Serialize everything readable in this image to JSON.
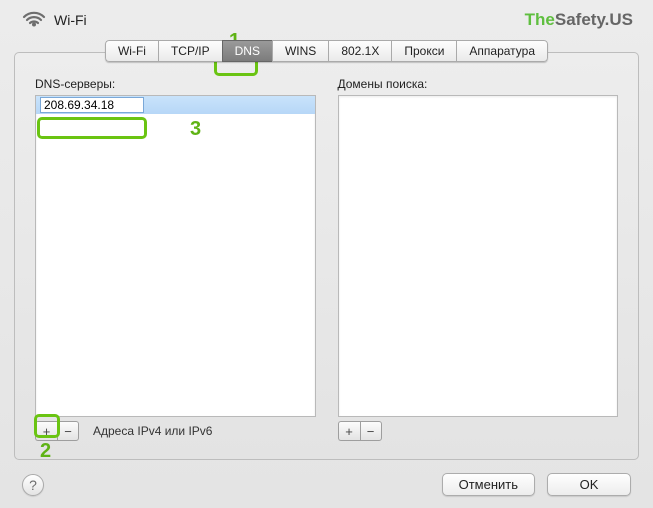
{
  "header": {
    "title": "Wi-Fi"
  },
  "brand": {
    "t1": "The",
    "t2": "Safety",
    "t3": ".US"
  },
  "tabs": {
    "t0": "Wi-Fi",
    "t1": "TCP/IP",
    "t2": "DNS",
    "t3": "WINS",
    "t4": "802.1X",
    "t5": "Прокси",
    "t6": "Аппаратура"
  },
  "left": {
    "label": "DNS-серверы:",
    "entry": "208.69.34.18",
    "hint": "Адреса IPv4 или IPv6"
  },
  "right": {
    "label": "Домены поиска:"
  },
  "pm": {
    "plus": "+",
    "minus": "−"
  },
  "footer": {
    "help": "?",
    "cancel": "Отменить",
    "ok": "OK"
  },
  "annotations": {
    "n1": "1",
    "n2": "2",
    "n3": "3"
  }
}
